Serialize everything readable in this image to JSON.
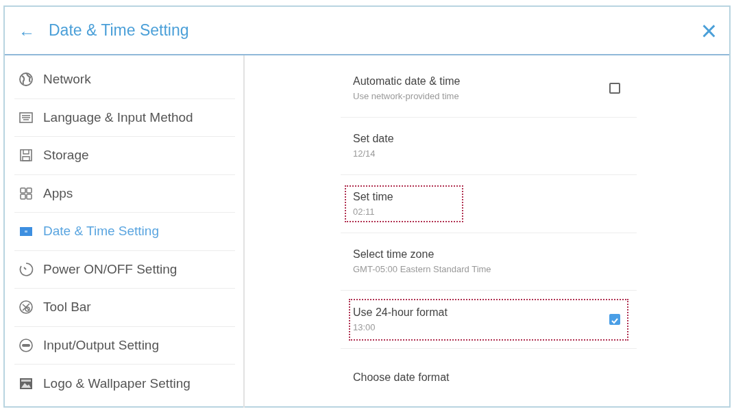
{
  "header": {
    "back": "←",
    "title": "Date & Time Setting",
    "close": "×"
  },
  "sidebar": {
    "items": [
      {
        "label": "Network",
        "selected": false
      },
      {
        "label": "Language & Input Method",
        "selected": false
      },
      {
        "label": "Storage",
        "selected": false
      },
      {
        "label": "Apps",
        "selected": false
      },
      {
        "label": "Date & Time Setting",
        "selected": true
      },
      {
        "label": "Power ON/OFF Setting",
        "selected": false
      },
      {
        "label": "Tool Bar",
        "selected": false
      },
      {
        "label": "Input/Output Setting",
        "selected": false
      },
      {
        "label": "Logo & Wallpaper Setting",
        "selected": false
      }
    ]
  },
  "settings": [
    {
      "kind": "checkbox",
      "title": "Automatic date & time",
      "summary": "Use network-provided time",
      "checked": false,
      "label_highlighted": false,
      "row_highlighted": false
    },
    {
      "kind": "plain",
      "title": "Set date",
      "summary": "12/14",
      "label_highlighted": false,
      "row_highlighted": false
    },
    {
      "kind": "plain",
      "title": "Set time",
      "summary": "02:11",
      "label_highlighted": true,
      "row_highlighted": false
    },
    {
      "kind": "plain",
      "title": "Select time zone",
      "summary": "GMT-05:00 Eastern Standard Time",
      "label_highlighted": false,
      "row_highlighted": false
    },
    {
      "kind": "checkbox",
      "title": "Use 24-hour format",
      "summary": "13:00",
      "checked": true,
      "label_highlighted": false,
      "row_highlighted": true
    },
    {
      "kind": "plain",
      "title": "Choose date format",
      "label_highlighted": false,
      "row_highlighted": false
    }
  ]
}
